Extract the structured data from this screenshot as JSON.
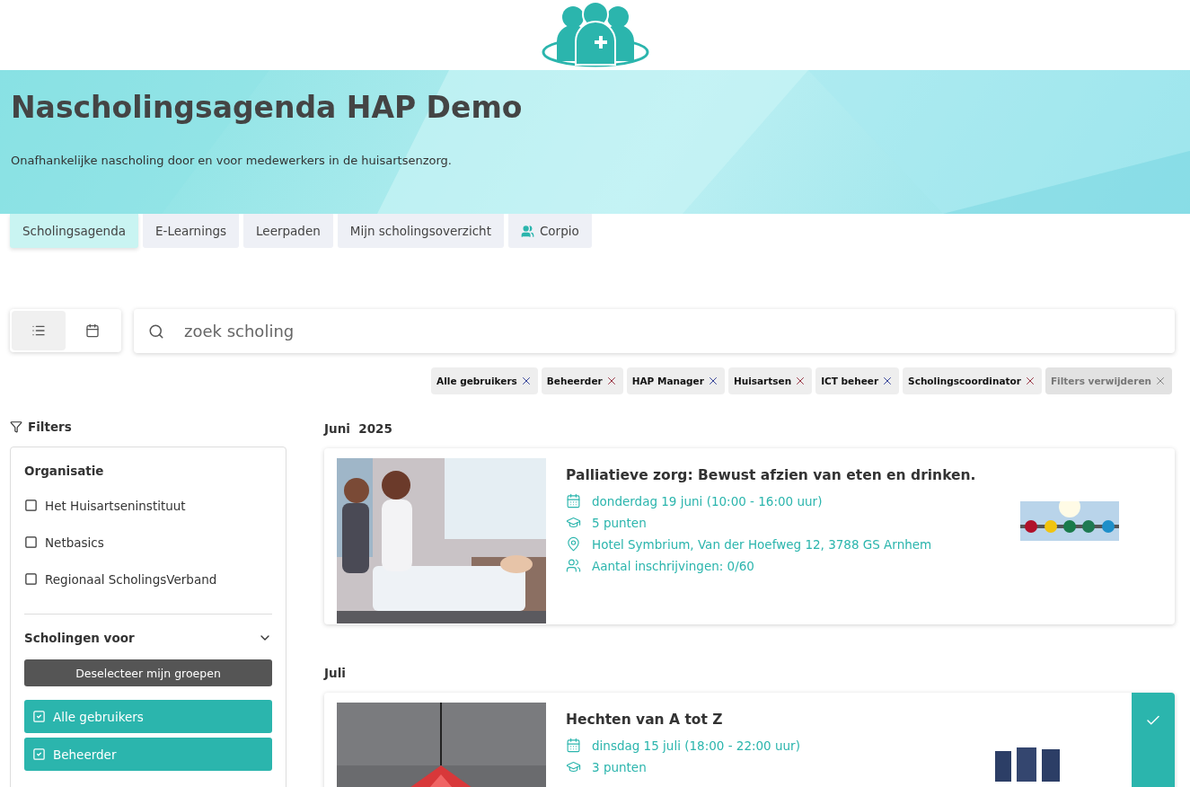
{
  "header": {
    "title": "Nascholingsagenda HAP Demo",
    "subtitle": "Onafhankelijke nascholing door en voor medewerkers in de huisartsenzorg."
  },
  "tabs": [
    {
      "label": "Scholingsagenda",
      "selected": true,
      "icon": false
    },
    {
      "label": "E-Learnings",
      "selected": false,
      "icon": false
    },
    {
      "label": "Leerpaden",
      "selected": false,
      "icon": false
    },
    {
      "label": "Mijn scholingsoverzicht",
      "selected": false,
      "icon": false
    },
    {
      "label": "Corpio",
      "selected": false,
      "icon": true
    }
  ],
  "view_toggle": [
    {
      "kind": "list",
      "selected": true
    },
    {
      "kind": "calendar",
      "selected": false
    }
  ],
  "search": {
    "placeholder": "zoek scholing"
  },
  "active_filters": [
    {
      "label": "Alle gebruikers",
      "kind": "filter"
    },
    {
      "label": "Beheerder",
      "kind": "filter"
    },
    {
      "label": "HAP Manager",
      "kind": "filter"
    },
    {
      "label": "Huisartsen",
      "kind": "filter"
    },
    {
      "label": "ICT beheer",
      "kind": "filter"
    },
    {
      "label": "Scholingscoordinator",
      "kind": "filter"
    },
    {
      "label": "Filters verwijderen",
      "kind": "clear"
    }
  ],
  "sidebar": {
    "heading": "Filters",
    "organisation": {
      "title": "Organisatie",
      "items": [
        {
          "label": "Het Huisartseninstituut",
          "checked": false
        },
        {
          "label": "Netbasics",
          "checked": false
        },
        {
          "label": "Regionaal ScholingsVerband",
          "checked": false
        }
      ]
    },
    "groups": {
      "title": "Scholingen voor",
      "expanded": true,
      "button": "Deselecteer mijn groepen",
      "items": [
        {
          "label": "Alle gebruikers",
          "checked": true
        },
        {
          "label": "Beheerder",
          "checked": true
        }
      ]
    }
  },
  "months": [
    {
      "title": "Juni  2025",
      "events": [
        {
          "title": "Palliatieve zorg: Bewust afzien van eten en drinken.",
          "registered": false,
          "details": [
            {
              "kind": "date",
              "text": "donderdag 19 juni (10:00 - 16:00 uur)"
            },
            {
              "kind": "points",
              "text": "5 punten"
            },
            {
              "kind": "location",
              "text": "Hotel Symbrium, Van der Hoefweg 12, 3788 GS Arnhem"
            },
            {
              "kind": "registrations",
              "text": "Aantal inschrijvingen: 0/60"
            }
          ]
        }
      ]
    },
    {
      "title": "Juli",
      "events": [
        {
          "title": "Hechten van A tot Z",
          "registered": true,
          "details": [
            {
              "kind": "date",
              "text": "dinsdag 15 juli (18:00 - 22:00 uur)"
            },
            {
              "kind": "points",
              "text": "3 punten"
            }
          ]
        }
      ]
    }
  ]
}
